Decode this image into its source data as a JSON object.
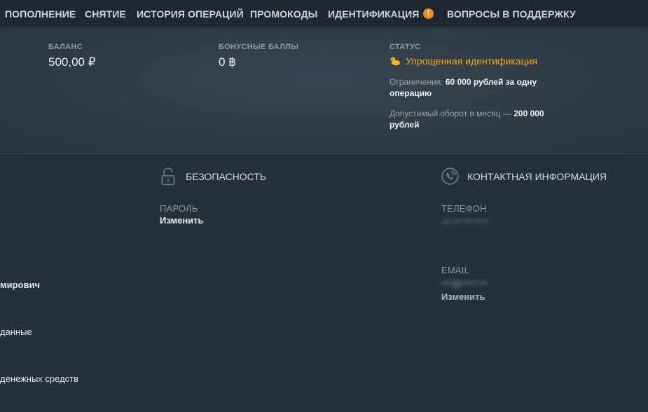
{
  "nav": {
    "items": [
      "ПОПОЛНЕНИЕ",
      "СНЯТИЕ",
      "ИСТОРИЯ ОПЕРАЦИЙ",
      "ПРОМОКОДЫ",
      "ИДЕНТИФИКАЦИЯ",
      "ВОПРОСЫ В ПОДДЕРЖКУ"
    ],
    "warning_badge": "!"
  },
  "summary": {
    "balance_label": "БАЛАНС",
    "balance_value": "500,00 ₽",
    "bonus_label": "БОНУСНЫЕ БАЛЛЫ",
    "bonus_value": "0 ฿",
    "status_label": "СТАТУС",
    "status_value": "Упрощенная идентификация",
    "limits_prefix": "Ограничения: ",
    "limits_value": "60 000 рублей за одну операцию",
    "turnover_prefix": "Допустимый оборот в месяц — ",
    "turnover_value": "200 000 рублей"
  },
  "security": {
    "title": "БЕЗОПАСНОСТЬ",
    "password_label": "ПАРОЛЬ",
    "password_action": "Изменить"
  },
  "contact": {
    "title": "КОНТАКТНАЯ ИНФОРМАЦИЯ",
    "phone_label": "ТЕЛЕФОН",
    "phone_value": "+7 *** *** ** **",
    "email_label": "EMAIL",
    "email_value": "****@*****.***",
    "email_action": "Изменить"
  },
  "left": {
    "name_fragment": "мирович",
    "data_fragment": "данные",
    "funds_fragment": "денежных средств"
  },
  "colors": {
    "accent": "#f0a81c",
    "warning": "#f08c18",
    "background": "#26303c"
  }
}
